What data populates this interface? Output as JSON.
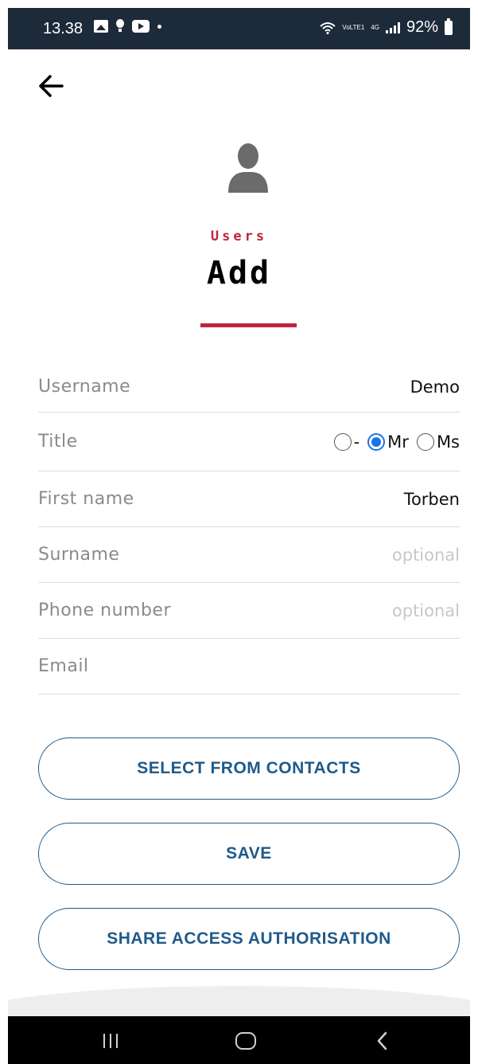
{
  "status_bar": {
    "time": "13.38",
    "network_volte": "VoLTE1",
    "network_4g": "4G",
    "battery": "92%"
  },
  "header": {
    "section_label": "Users",
    "title": "Add"
  },
  "form": {
    "username_label": "Username",
    "username_value": "Demo",
    "title_label": "Title",
    "title_options": [
      "-",
      "Mr",
      "Ms"
    ],
    "title_selected": "Mr",
    "first_name_label": "First name",
    "first_name_value": "Torben",
    "surname_label": "Surname",
    "surname_placeholder": "optional",
    "phone_label": "Phone number",
    "phone_placeholder": "optional",
    "email_label": "Email",
    "email_value": ""
  },
  "buttons": {
    "select_contacts": "SELECT FROM CONTACTS",
    "save": "SAVE",
    "share_access": "SHARE ACCESS AUTHORISATION"
  },
  "colors": {
    "accent_red": "#c0243e",
    "button_blue": "#1f5a8a",
    "radio_blue": "#1a73e8",
    "status_bar_bg": "#1d2a3a"
  }
}
